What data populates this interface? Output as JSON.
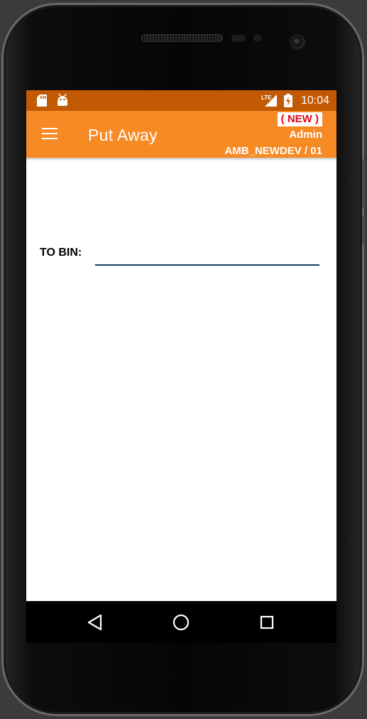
{
  "status_bar": {
    "time": "10:04",
    "left_icons": [
      "sd-card-icon",
      "android-icon"
    ],
    "right_icons": [
      "lte-signal-icon",
      "battery-charging-icon"
    ]
  },
  "app_bar": {
    "title": "Put Away",
    "badge": "( NEW )",
    "user": "Admin",
    "device": "AMB_NEWDEV / 01",
    "colors": {
      "app_bar": "#f68a25",
      "status_bar": "#c25a05",
      "badge_text": "#e3061a"
    }
  },
  "form": {
    "to_bin_label": "TO BIN:",
    "to_bin_value": "",
    "to_bin_placeholder": ""
  },
  "nav_bar": {
    "buttons": [
      "back-icon",
      "home-icon",
      "recents-icon"
    ]
  }
}
